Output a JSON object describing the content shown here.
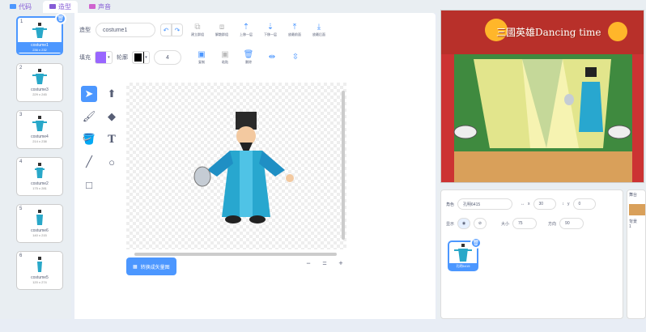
{
  "tabs": [
    {
      "label": "代码"
    },
    {
      "label": "造型"
    },
    {
      "label": "声音"
    }
  ],
  "costumes": [
    {
      "num": "1",
      "name": "costume1",
      "size": "236 x 232",
      "selected": true
    },
    {
      "num": "2",
      "name": "costume3",
      "size": "229 x 245",
      "selected": false
    },
    {
      "num": "3",
      "name": "costume4",
      "size": "214 x 238",
      "selected": false
    },
    {
      "num": "4",
      "name": "costume2",
      "size": "175 x 281",
      "selected": false
    },
    {
      "num": "5",
      "name": "costume6",
      "size": "140 x 215",
      "selected": false
    },
    {
      "num": "6",
      "name": "costume5",
      "size": "120 x 274",
      "selected": false
    }
  ],
  "editor": {
    "costume_label": "造型",
    "costume_name": "costume1",
    "fill_label": "填充",
    "outline_label": "轮廓",
    "outline_width": "4",
    "fill_color": "#9966ff",
    "outline_color": "#000000",
    "buttons": [
      {
        "label": "建立群组"
      },
      {
        "label": "解散群组"
      },
      {
        "label": "上移一层"
      },
      {
        "label": "下移一层"
      },
      {
        "label": "放最前面"
      },
      {
        "label": "放最后面"
      }
    ],
    "buttons2": [
      {
        "label": "复制"
      },
      {
        "label": "粘贴"
      },
      {
        "label": "删除"
      }
    ],
    "convert_label": "转换成矢量图",
    "zoom_out": "−",
    "zoom_reset": "=",
    "zoom_in": "+"
  },
  "stage": {
    "title": "三國英雄Dancing time"
  },
  "sprite": {
    "name_label": "角色",
    "name_value": "孔明6415",
    "x_label": "x",
    "x_value": "30",
    "y_label": "y",
    "y_value": "0",
    "show_label": "显示",
    "size_label": "大小",
    "size_value": "75",
    "direction_label": "方向",
    "direction_value": "90",
    "tile_label": "孔明6415"
  },
  "stage_panel": {
    "label": "舞台",
    "backdrops_label": "背景",
    "backdrops_count": "1"
  },
  "colors": {
    "accent": "#4c97ff",
    "text": "#575e75"
  }
}
